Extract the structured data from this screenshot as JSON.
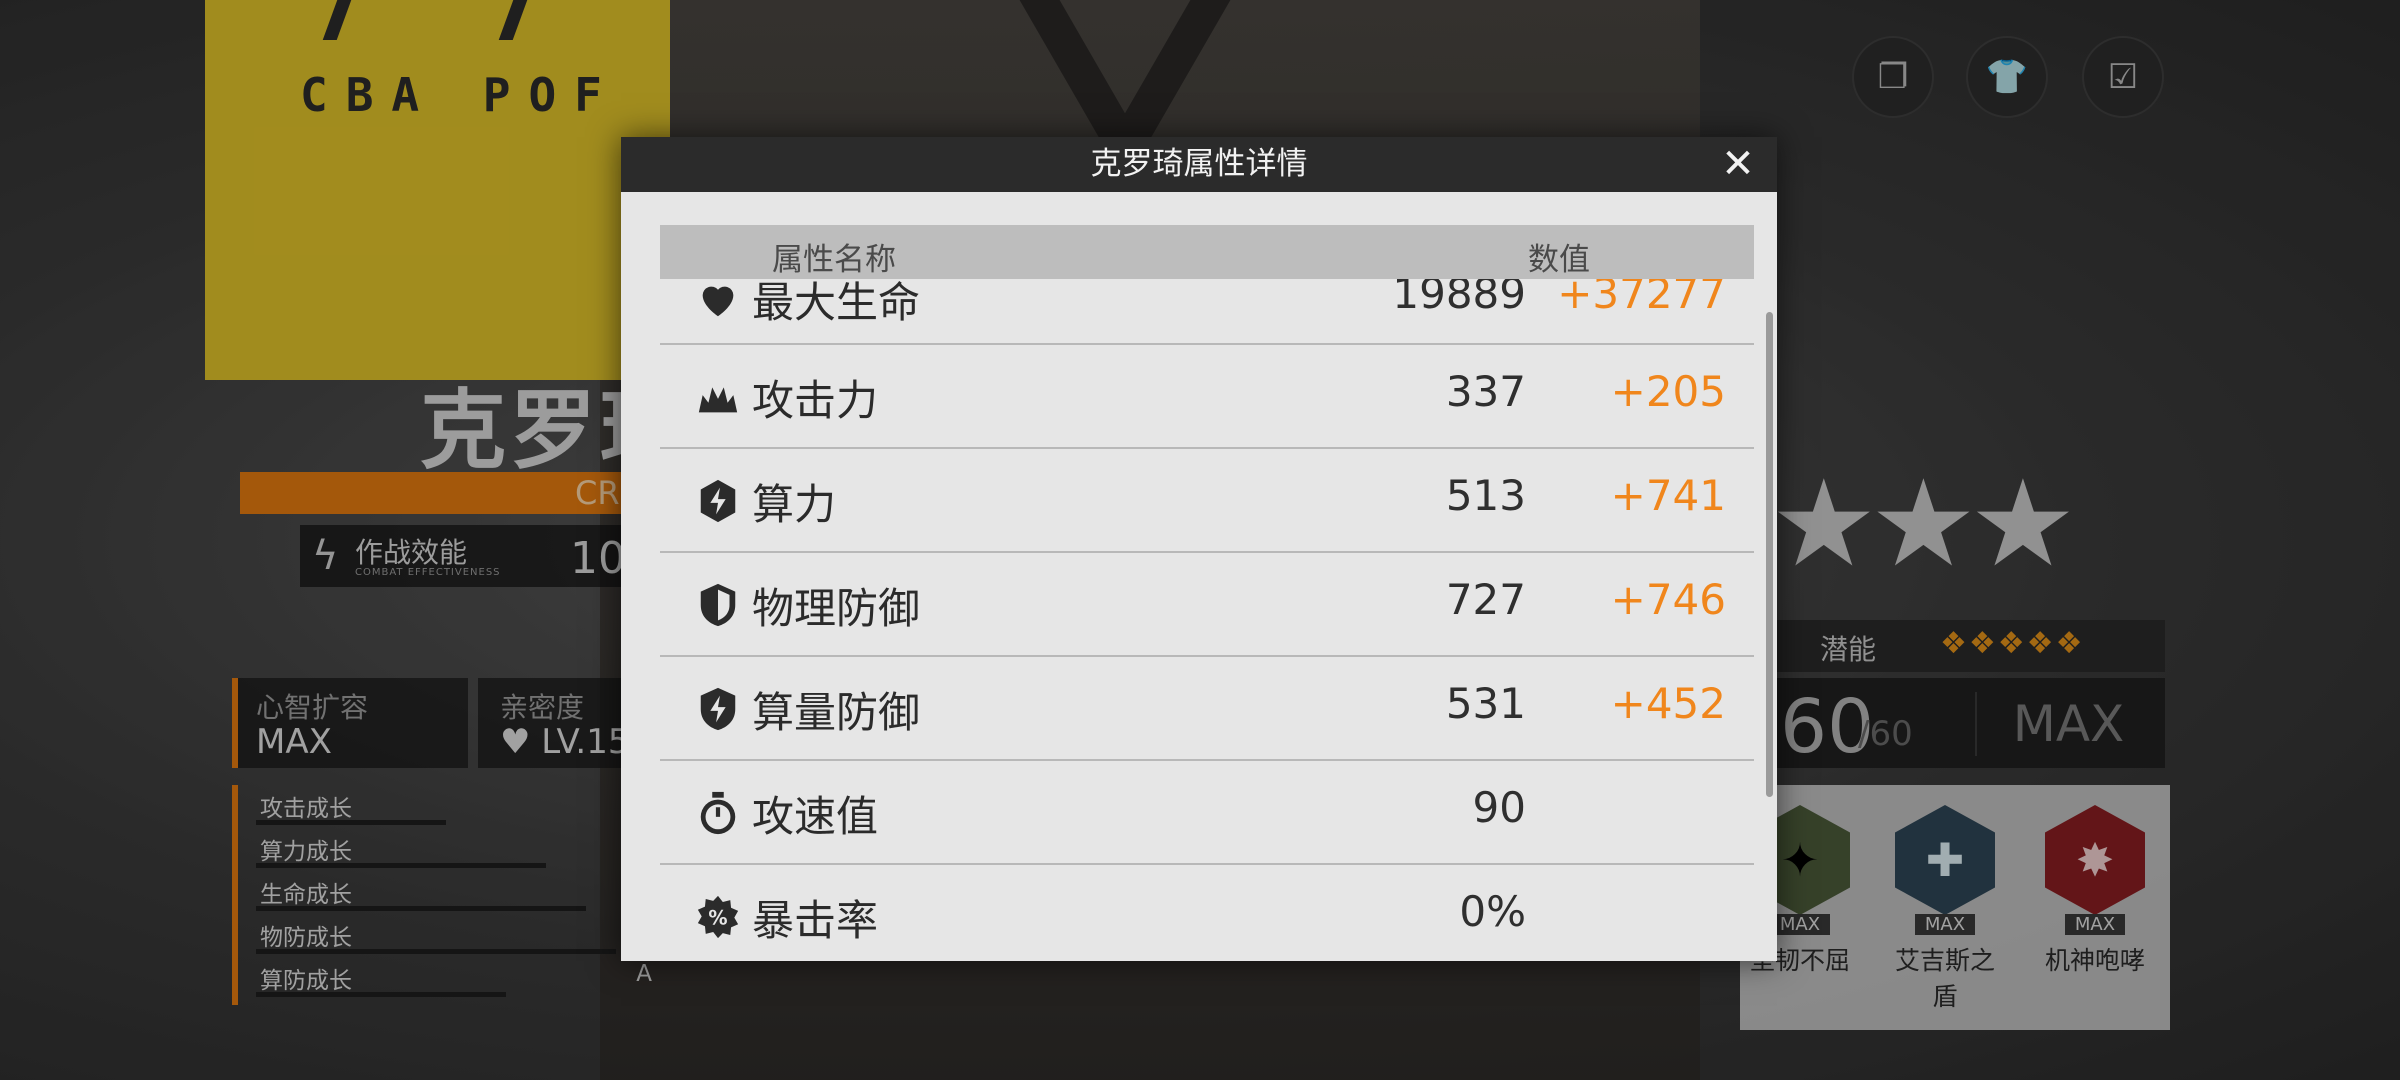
{
  "background": {
    "banner_logo": "CBA POF",
    "character_name": "克罗琦",
    "name_subtitle": "CRO",
    "combat": {
      "label": "作战效能",
      "sub": "COMBAT EFFECTIVENESS",
      "value": "106"
    },
    "mind_expansion": {
      "title": "心智扩容",
      "value": "MAX"
    },
    "affinity": {
      "title": "亲密度",
      "value": "LV.15"
    },
    "growth": [
      {
        "label": "攻击成长",
        "grade": ""
      },
      {
        "label": "算力成长",
        "grade": ""
      },
      {
        "label": "生命成长",
        "grade": ""
      },
      {
        "label": "物防成长",
        "grade": ""
      },
      {
        "label": "算防成长",
        "grade": "A"
      }
    ],
    "potential": {
      "label": "潜能",
      "diamonds": "❖❖❖❖❖"
    },
    "level": {
      "current": "60",
      "max": "/60",
      "status": "MAX"
    },
    "skills": [
      {
        "name": "坚韧不屈",
        "tag": "MAX"
      },
      {
        "name": "艾吉斯之盾",
        "tag": "MAX"
      },
      {
        "name": "机神咆哮",
        "tag": "MAX"
      }
    ],
    "stars": "★★★"
  },
  "modal": {
    "title": "克罗琦属性详情",
    "close": "✕",
    "header": {
      "name": "属性名称",
      "value": "数值"
    },
    "rows": [
      {
        "icon": "heart-icon",
        "name": "最大生命",
        "base": "19889",
        "bonus": "+37277"
      },
      {
        "icon": "burst-icon",
        "name": "攻击力",
        "base": "337",
        "bonus": "+205"
      },
      {
        "icon": "bolt-shield-icon",
        "name": "算力",
        "base": "513",
        "bonus": "+741"
      },
      {
        "icon": "shield-icon",
        "name": "物理防御",
        "base": "727",
        "bonus": "+746"
      },
      {
        "icon": "bolt-shield-icon",
        "name": "算量防御",
        "base": "531",
        "bonus": "+452"
      },
      {
        "icon": "stopwatch-icon",
        "name": "攻速值",
        "base": "90",
        "bonus": ""
      },
      {
        "icon": "percent-gear-icon",
        "name": "暴击率",
        "base": "0%",
        "bonus": ""
      }
    ]
  },
  "colors": {
    "bonus": "#f0861c",
    "accent": "#e37b10",
    "header": "#2b2b2b"
  }
}
